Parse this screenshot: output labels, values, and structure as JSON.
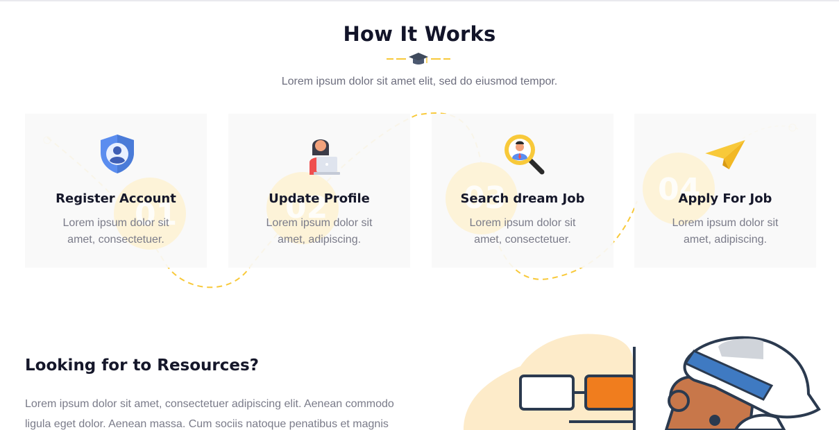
{
  "section": {
    "title": "How It Works",
    "subtitle": "Lorem ipsum dolor sit amet elit, sed do eiusmod tempor."
  },
  "steps": [
    {
      "number": "01",
      "title": "Register Account",
      "desc": "Lorem ipsum dolor sit amet, consectetuer.",
      "icon": "shield-user-icon"
    },
    {
      "number": "02",
      "title": "Update Profile",
      "desc": "Lorem ipsum dolor sit amet, adipiscing.",
      "icon": "person-laptop-icon"
    },
    {
      "number": "03",
      "title": "Search dream Job",
      "desc": "Lorem ipsum dolor sit amet, consectetuer.",
      "icon": "magnifier-person-icon"
    },
    {
      "number": "04",
      "title": "Apply For Job",
      "desc": "Lorem ipsum dolor sit amet, adipiscing.",
      "icon": "paper-plane-icon"
    }
  ],
  "resources": {
    "title": "Looking for to Resources?",
    "text": "Lorem ipsum dolor sit amet, consectetuer adipiscing elit. Aenean commodo ligula eget dolor. Aenean massa. Cum sociis natoque penatibus et magnis"
  },
  "colors": {
    "accent": "#f8c93a",
    "heading": "#121429",
    "body_text": "#7a7b89",
    "card_bg": "#f9f9f9"
  }
}
